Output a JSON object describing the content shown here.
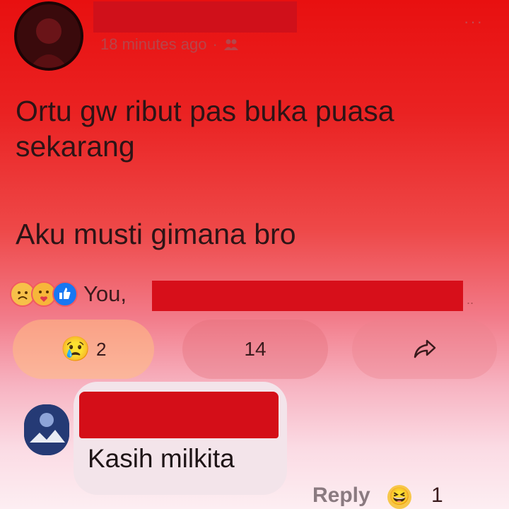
{
  "post": {
    "time": "18 minutes ago",
    "separator": "·",
    "privacy_icon": "friends-icon",
    "more": "···",
    "lines": [
      "Ortu gw ribut pas buka puasa sekarang",
      "Aku musti gimana bro"
    ]
  },
  "reactions": {
    "icons": [
      "sad-face-icon",
      "care-hug-icon",
      "like-thumb-icon"
    ],
    "names_prefix": "You,",
    "more": ".."
  },
  "actions": {
    "react_count": "2",
    "comment_count": "14",
    "share_icon": "share-arrow-icon"
  },
  "comment": {
    "text": "Kasih milkita",
    "reply_label": "Reply",
    "reaction_icon": "laughing-face-icon",
    "reaction_count": "1"
  },
  "colors": {
    "background_top": "#e81010",
    "background_bottom": "#fdeef2",
    "redaction": "#d70f1a",
    "like_blue": "#1877f2"
  }
}
